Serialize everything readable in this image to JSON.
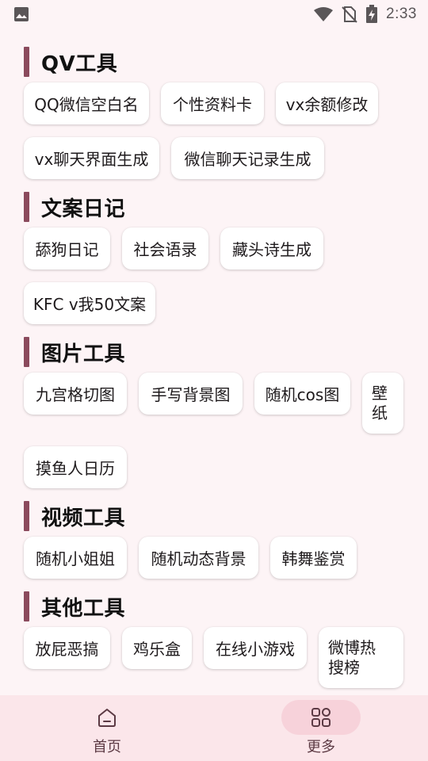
{
  "status_bar": {
    "time": "2:33",
    "icons": [
      "image-icon",
      "wifi-icon",
      "no-sim-icon",
      "battery-charging-icon"
    ]
  },
  "sections": [
    {
      "title": "QV工具",
      "items": [
        "QQ微信空白名",
        "个性资料卡",
        "vx余额修改",
        "vx聊天界面生成",
        "微信聊天记录生成"
      ]
    },
    {
      "title": "文案日记",
      "items": [
        "舔狗日记",
        "社会语录",
        "藏头诗生成",
        "KFC v我50文案"
      ]
    },
    {
      "title": "图片工具",
      "items": [
        "九宫格切图",
        "手写背景图",
        "随机cos图",
        "壁纸",
        "摸鱼人日历"
      ]
    },
    {
      "title": "视频工具",
      "items": [
        "随机小姐姐",
        "随机动态背景",
        "韩舞鉴赏"
      ]
    },
    {
      "title": "其他工具",
      "items": [
        "放屁恶搞",
        "鸡乐盒",
        "在线小游戏",
        "微博热搜榜"
      ]
    }
  ],
  "bottom_nav": {
    "home_label": "首页",
    "more_label": "更多",
    "active": "more",
    "colors": {
      "background": "#fbe6ea",
      "active_pill": "#f7d2da",
      "accent": "#8b4a5d"
    }
  }
}
